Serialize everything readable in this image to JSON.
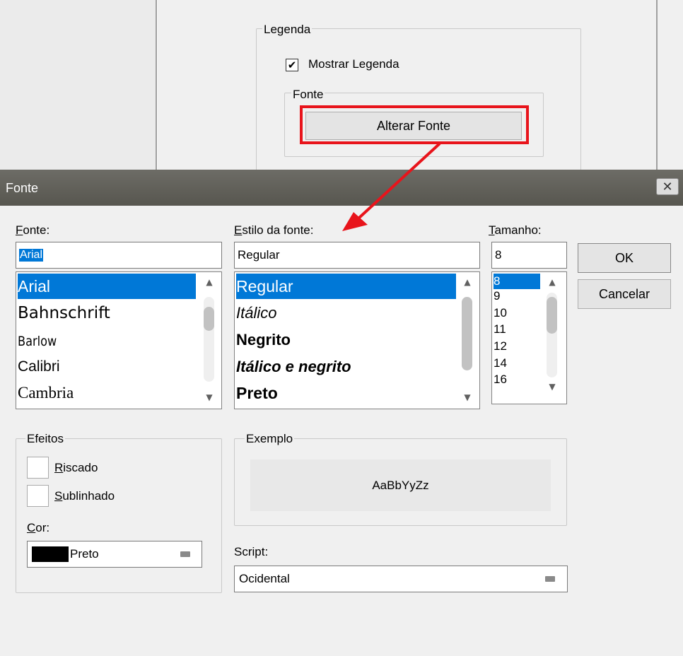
{
  "background_panel": {
    "legend_group_label": "Legenda",
    "show_legend_label": "Mostrar Legenda",
    "show_legend_checked": "✔",
    "font_group_label": "Fonte",
    "change_font_button": "Alterar Fonte",
    "highlight_color": "#e8141b"
  },
  "dialog": {
    "title": "Fonte",
    "close_glyph": "✕",
    "font": {
      "label_first": "F",
      "label_rest": "onte:",
      "value": "Arial",
      "items": [
        "Arial",
        "Bahnschrift",
        "Barlow",
        "Calibri",
        "Cambria"
      ],
      "selected_index": 0
    },
    "style": {
      "label_first": "E",
      "label_rest": "stilo da fonte:",
      "value": "Regular",
      "items": [
        "Regular",
        "Itálico",
        "Negrito",
        "Itálico e negrito",
        "Preto"
      ],
      "selected_index": 0
    },
    "size": {
      "label_first": "T",
      "label_rest": "amanho:",
      "value": "8",
      "items": [
        "8",
        "9",
        "10",
        "11",
        "12",
        "14",
        "16"
      ],
      "selected_index": 0
    },
    "ok_button": "OK",
    "cancel_button": "Cancelar",
    "effects": {
      "group_label": "Efeitos",
      "strike_first": "R",
      "strike_rest": "iscado",
      "underline_first": "S",
      "underline_rest": "ublinhado",
      "color_first": "C",
      "color_rest": "or:",
      "color_value": "Preto",
      "color_swatch": "#000000"
    },
    "sample": {
      "group_label": "Exemplo",
      "text": "AaBbYyZz"
    },
    "script": {
      "label": "Script:",
      "value": "Ocidental"
    }
  },
  "icons": [
    "checkmark-icon",
    "close-icon",
    "arrow-icon",
    "scroll-up-icon",
    "scroll-down-icon",
    "dropdown-icon"
  ]
}
